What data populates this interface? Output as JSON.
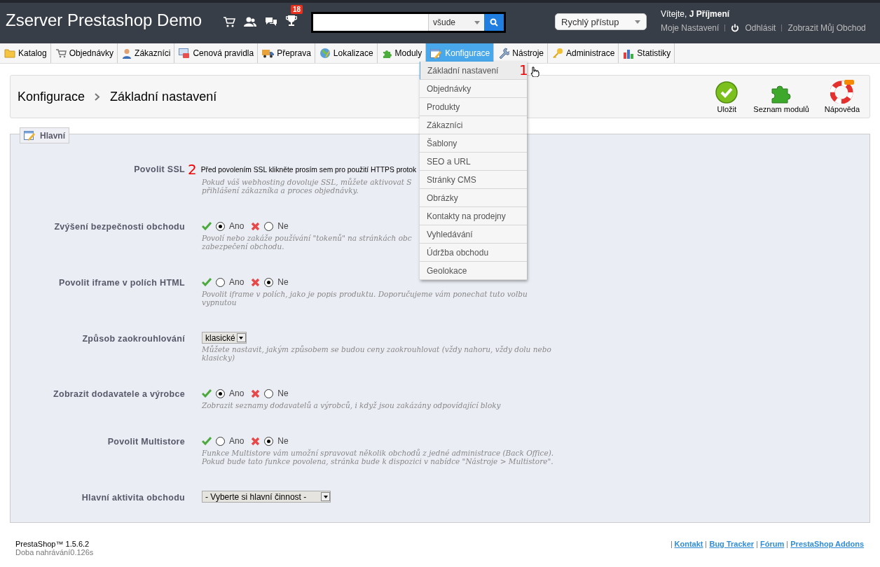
{
  "header": {
    "shop_name": "Zserver Prestashop Demo",
    "notification_badge": "18",
    "search": {
      "scope": "všude"
    },
    "quick_access": "Rychlý přístup",
    "welcome": "Vítejte,",
    "user_name": "J Příjmení",
    "links": [
      "Moje Nastavení",
      "Odhlásit",
      "Zobrazit Můj Obchod"
    ]
  },
  "tabs": [
    {
      "label": "Katalog",
      "selected": false
    },
    {
      "label": "Objednávky",
      "selected": false
    },
    {
      "label": "Zákazníci",
      "selected": false
    },
    {
      "label": "Cenová pravidla",
      "selected": false
    },
    {
      "label": "Přeprava",
      "selected": false
    },
    {
      "label": "Lokalizace",
      "selected": false
    },
    {
      "label": "Moduly",
      "selected": false
    },
    {
      "label": "Konfigurace",
      "selected": true
    },
    {
      "label": "Nástroje",
      "selected": false
    },
    {
      "label": "Administrace",
      "selected": false
    },
    {
      "label": "Statistiky",
      "selected": false
    }
  ],
  "submenu": [
    {
      "label": "Základní nastavení",
      "selected": true
    },
    {
      "label": "Objednávky",
      "selected": false
    },
    {
      "label": "Produkty",
      "selected": false
    },
    {
      "label": "Zákazníci",
      "selected": false
    },
    {
      "label": "Šablony",
      "selected": false
    },
    {
      "label": "SEO a URL",
      "selected": false
    },
    {
      "label": "Stránky CMS",
      "selected": false
    },
    {
      "label": "Obrázky",
      "selected": false
    },
    {
      "label": "Kontakty na prodejny",
      "selected": false
    },
    {
      "label": "Vyhledávání",
      "selected": false
    },
    {
      "label": "Údržba obchodu",
      "selected": false
    },
    {
      "label": "Geolokace",
      "selected": false
    }
  ],
  "annotations": [
    "1",
    "2"
  ],
  "breadcrumb": [
    "Konfigurace",
    "Základní nastavení"
  ],
  "toolbar": [
    "Uložit",
    "Seznam modulů",
    "Nápověda"
  ],
  "fieldset": {
    "legend": "Hlavní",
    "rows": [
      {
        "kind": "link",
        "label": "Povolit SSL",
        "text": "Před povolením SSL klikněte prosím sem pro použití HTTPS protok",
        "description": [
          "Pokud váš webhosting dovoluje SSL, můžete aktivovat S",
          "přihlášení zákazníka a proces objednávky."
        ]
      },
      {
        "kind": "radio",
        "label": "Zvýšení bezpečnosti obchodu",
        "options": [
          {
            "label": "Ano",
            "selected": true
          },
          {
            "label": "Ne",
            "selected": false
          }
        ],
        "description": [
          "Povolí nebo zakáže používání \"tokenů\" na stránkách obc",
          "zabezpečení obchodu."
        ]
      },
      {
        "kind": "radio",
        "label": "Povolit iframe v polích HTML",
        "options": [
          {
            "label": "Ano",
            "selected": false
          },
          {
            "label": "Ne",
            "selected": true
          }
        ],
        "description": [
          "Povolit iframe v polích, jako je popis produktu. Doporučujeme vám ponechat tuto volbu vypnutou"
        ]
      },
      {
        "kind": "select",
        "label": "Způsob zaokrouhlování",
        "value": "klasické",
        "description": [
          "Můžete nastavit, jakým způsobem se budou ceny zaokrouhlovat (vždy nahoru, vždy dolu nebo klasicky)"
        ]
      },
      {
        "kind": "radio",
        "label": "Zobrazit dodavatele a výrobce",
        "options": [
          {
            "label": "Ano",
            "selected": true
          },
          {
            "label": "Ne",
            "selected": false
          }
        ],
        "description": [
          "Zobrazit seznamy dodavatelů a výrobců, i když jsou zakázány odpovídající bloky"
        ]
      },
      {
        "kind": "radio",
        "label": "Povolit Multistore",
        "options": [
          {
            "label": "Ano",
            "selected": false
          },
          {
            "label": "Ne",
            "selected": true
          }
        ],
        "description": [
          "Funkce Multistore vám umožní spravovat několik obchodů z jedné administrace (Back Office). Pokud bude tato funkce povolena, stránka bude k dispozici v nabídce \"Nástroje > Multistore\"."
        ]
      },
      {
        "kind": "select",
        "label": "Hlavní aktivita obchodu",
        "value": "- Vyberte si hlavní činnost -",
        "description": []
      }
    ]
  },
  "footer": {
    "version": "PrestaShop™ 1.5.6.2",
    "load_time": "Doba nahrávání0.126s",
    "links": [
      "Kontakt",
      "Bug Tracker",
      "Fórum",
      "PrestaShop Addons"
    ]
  }
}
